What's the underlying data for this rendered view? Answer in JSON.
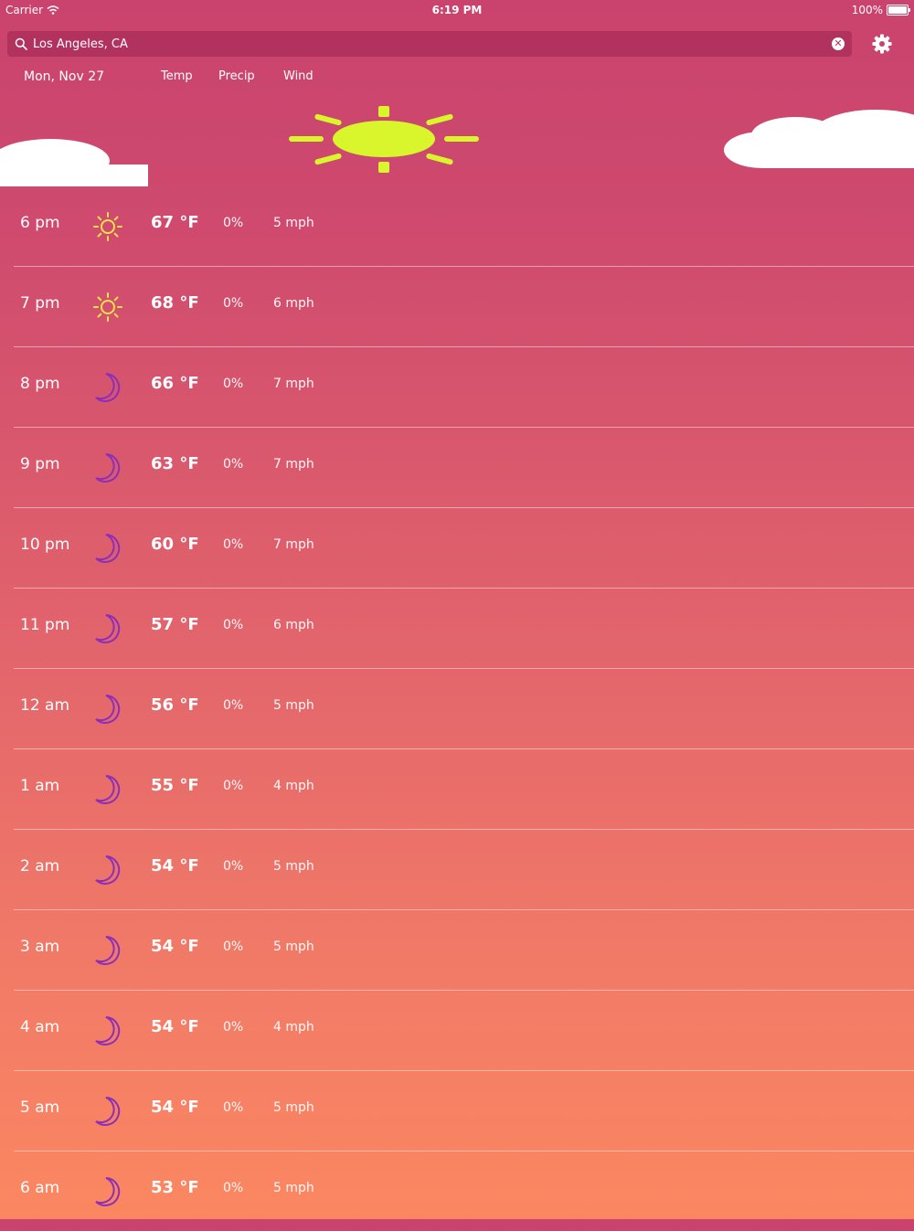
{
  "status": {
    "carrier": "Carrier",
    "time": "6:19 PM",
    "battery": "100%"
  },
  "search": {
    "value": "Los Angeles, CA",
    "placeholder": ""
  },
  "header": {
    "date": "Mon, Nov 27",
    "temp": "Temp",
    "precip": "Precip",
    "wind": "Wind"
  },
  "colors": {
    "sun": "#d9f52b",
    "sun_small": "#f1e24a",
    "moon": "#8b2fb8",
    "search_bg": "#b1325c"
  },
  "rows": [
    {
      "time": "6 pm",
      "icon": "sun-icon",
      "temp": "67 °F",
      "precip": "0%",
      "wind": "5 mph"
    },
    {
      "time": "7 pm",
      "icon": "sun-icon",
      "temp": "68 °F",
      "precip": "0%",
      "wind": "6 mph"
    },
    {
      "time": "8 pm",
      "icon": "moon-icon",
      "temp": "66 °F",
      "precip": "0%",
      "wind": "7 mph"
    },
    {
      "time": "9 pm",
      "icon": "moon-icon",
      "temp": "63 °F",
      "precip": "0%",
      "wind": "7 mph"
    },
    {
      "time": "10 pm",
      "icon": "moon-icon",
      "temp": "60 °F",
      "precip": "0%",
      "wind": "7 mph"
    },
    {
      "time": "11 pm",
      "icon": "moon-icon",
      "temp": "57 °F",
      "precip": "0%",
      "wind": "6 mph"
    },
    {
      "time": "12 am",
      "icon": "moon-icon",
      "temp": "56 °F",
      "precip": "0%",
      "wind": "5 mph"
    },
    {
      "time": "1 am",
      "icon": "moon-icon",
      "temp": "55 °F",
      "precip": "0%",
      "wind": "4 mph"
    },
    {
      "time": "2 am",
      "icon": "moon-icon",
      "temp": "54 °F",
      "precip": "0%",
      "wind": "5 mph"
    },
    {
      "time": "3 am",
      "icon": "moon-icon",
      "temp": "54 °F",
      "precip": "0%",
      "wind": "5 mph"
    },
    {
      "time": "4 am",
      "icon": "moon-icon",
      "temp": "54 °F",
      "precip": "0%",
      "wind": "4 mph"
    },
    {
      "time": "5 am",
      "icon": "moon-icon",
      "temp": "54 °F",
      "precip": "0%",
      "wind": "5 mph"
    },
    {
      "time": "6 am",
      "icon": "moon-icon",
      "temp": "53 °F",
      "precip": "0%",
      "wind": "5 mph"
    }
  ]
}
